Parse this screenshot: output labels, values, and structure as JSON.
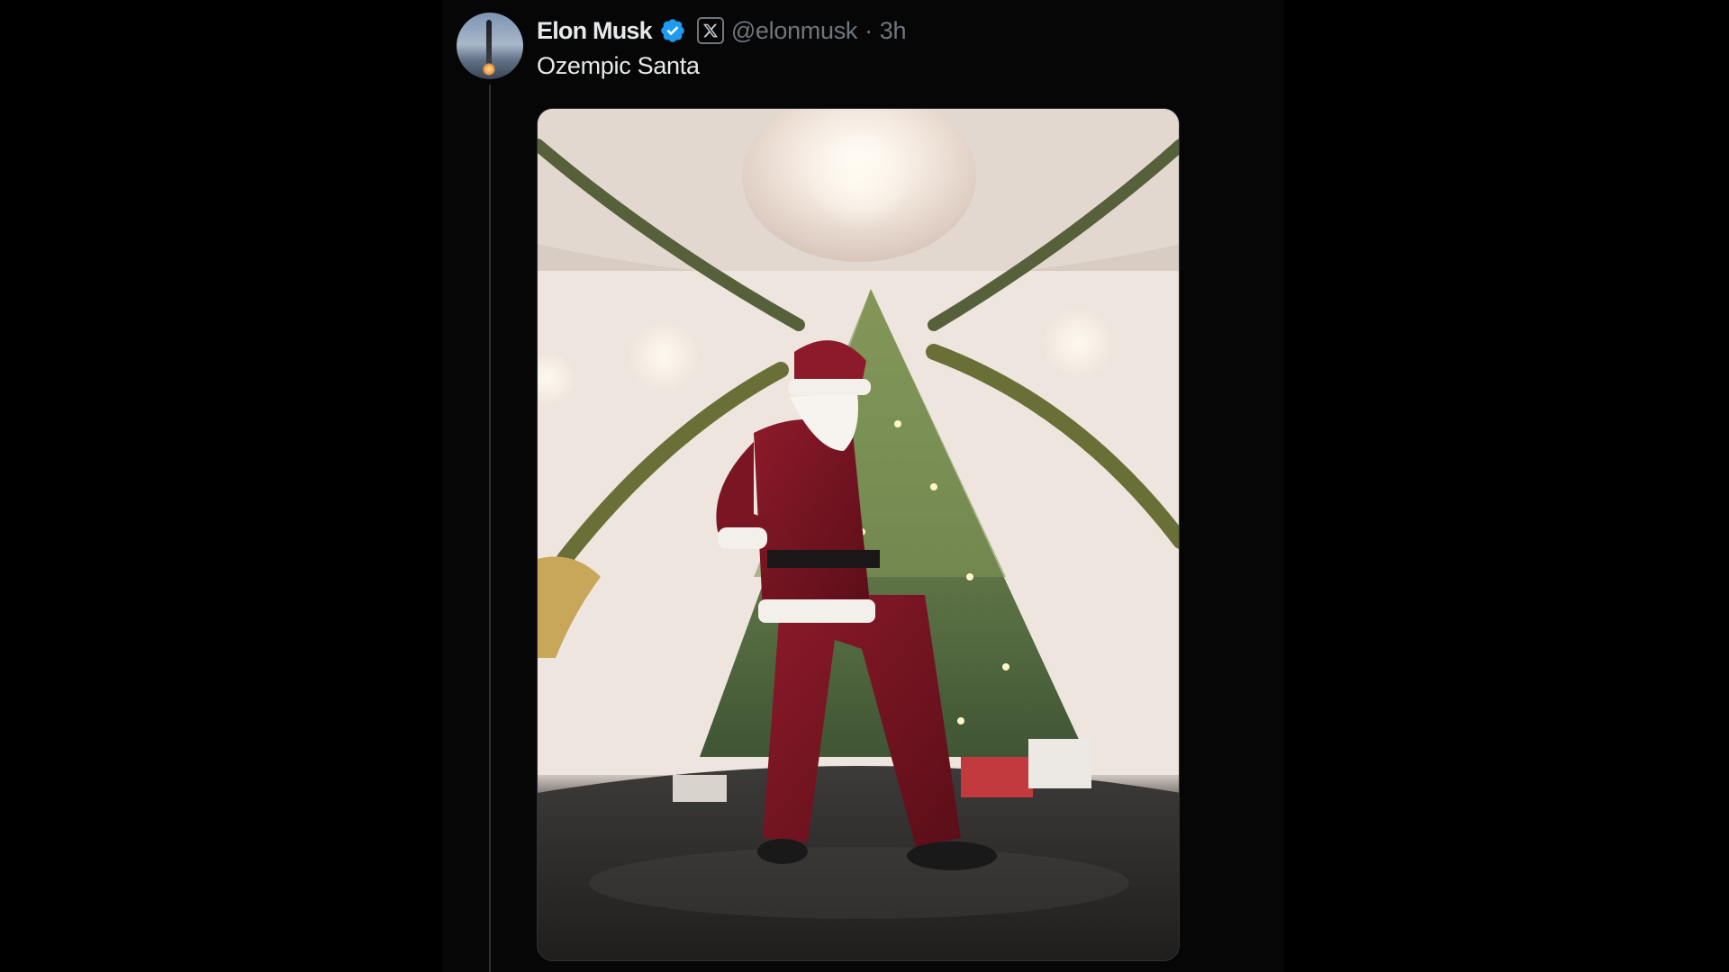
{
  "tweet": {
    "author": {
      "display_name": "Elon Musk",
      "handle": "@elonmusk",
      "verified": true,
      "verified_color": "#1d9bf0",
      "affiliate_badge_icon": "x-logo-icon",
      "avatar_icon": "rocket-launch-avatar"
    },
    "separator": "·",
    "timestamp": "3h",
    "text": "Ozempic Santa",
    "media": {
      "type": "photo",
      "subject": "person-in-santa-costume-with-christmas-tree"
    }
  },
  "colors": {
    "background": "#000000",
    "primary_text": "#e7e9ea",
    "secondary_text": "#71767b",
    "verified_blue": "#1d9bf0"
  }
}
